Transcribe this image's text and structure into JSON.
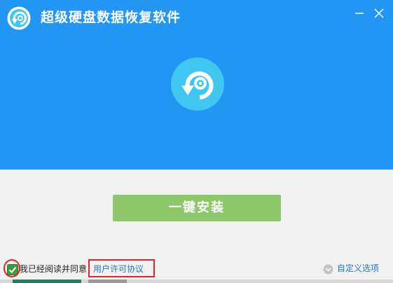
{
  "window": {
    "title": "超级硬盘数据恢复软件",
    "minimize_symbol": "—",
    "close_symbol": "×"
  },
  "main": {
    "install_button_label": "一键安装"
  },
  "footer": {
    "agree_text": "我已经阅读并同意",
    "license_link": "用户许可协议",
    "custom_options_link": "自定义选项",
    "agree_checked": true
  },
  "colors": {
    "header_blue": "#2196f3",
    "logo_circle": "#3fc7f2",
    "install_green": "#8ec86b",
    "link_blue": "#1d76d3",
    "highlight_red": "#e0252b"
  },
  "icons": {
    "app_logo": "restore-arrow-icon",
    "hero_logo": "restore-arrow-icon",
    "checkbox": "checkbox-checked-icon",
    "custom_options": "chevron-down-circle-icon"
  }
}
